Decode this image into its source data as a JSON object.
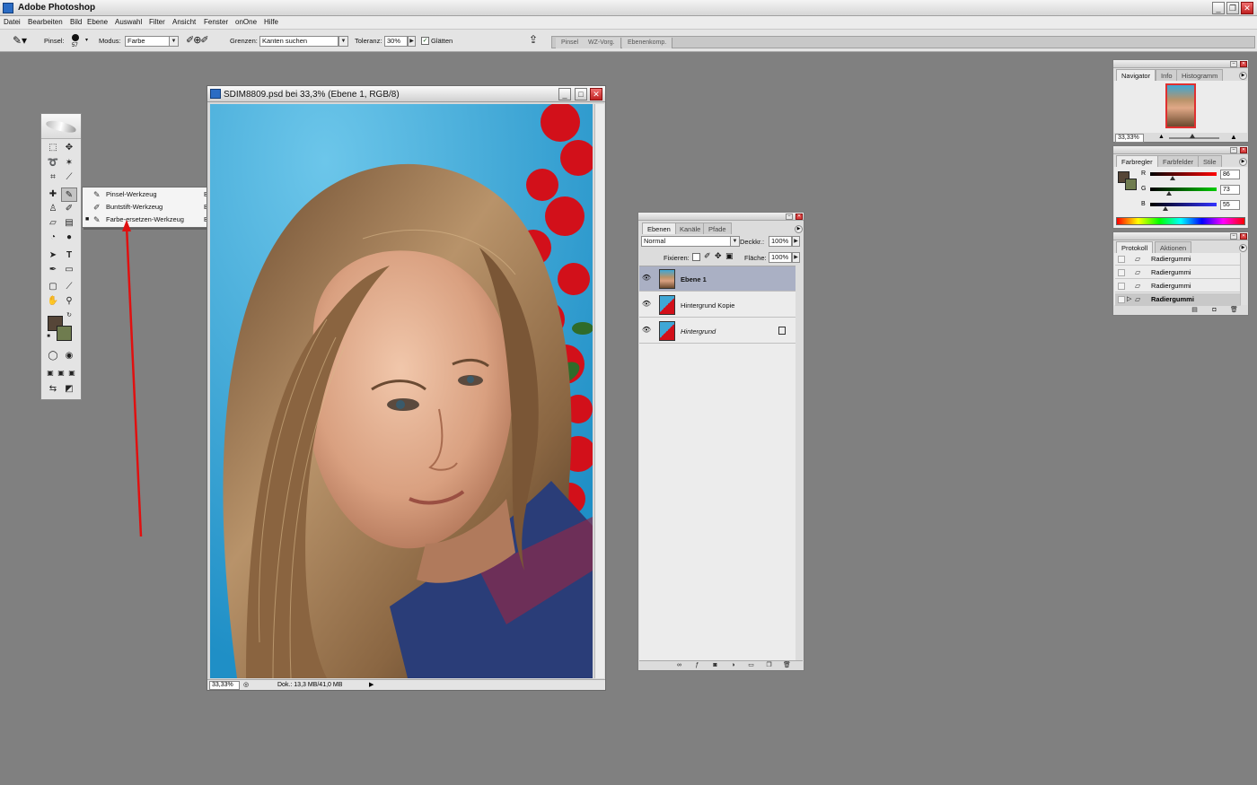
{
  "app": {
    "title": "Adobe Photoshop"
  },
  "menu": [
    "Datei",
    "Bearbeiten",
    "Bild",
    "Ebene",
    "Auswahl",
    "Filter",
    "Ansicht",
    "Fenster",
    "onOne",
    "Hilfe"
  ],
  "options": {
    "brush_label": "Pinsel:",
    "brush_size": "57",
    "mode_label": "Modus:",
    "mode_value": "Farbe",
    "limits_label": "Grenzen:",
    "limits_value": "Kanten suchen",
    "tolerance_label": "Toleranz:",
    "tolerance_value": "30%",
    "antialias_label": "Glätten",
    "antialias_checked": true
  },
  "palette_well": [
    "Pinsel",
    "WZ-Vorg.",
    "Ebenenkomp."
  ],
  "flyout": {
    "items": [
      {
        "label": "Pinsel-Werkzeug",
        "key": "B",
        "selected": false
      },
      {
        "label": "Buntstift-Werkzeug",
        "key": "B",
        "selected": false
      },
      {
        "label": "Farbe-ersetzen-Werkzeug",
        "key": "B",
        "selected": true
      }
    ]
  },
  "document": {
    "title": "SDIM8809.psd bei 33,3% (Ebene 1, RGB/8)",
    "zoom": "33,33%",
    "doc_info": "Dok.: 13,3 MB/41,0 MB"
  },
  "layers": {
    "tabs": [
      "Ebenen",
      "Kanäle",
      "Pfade"
    ],
    "blend_mode": "Normal",
    "opacity_label": "Deckkr.:",
    "opacity_value": "100%",
    "lock_label": "Fixieren:",
    "fill_label": "Fläche:",
    "fill_value": "100%",
    "items": [
      {
        "name": "Ebene 1",
        "selected": true,
        "locked": false
      },
      {
        "name": "Hintergrund Kopie",
        "selected": false,
        "locked": false
      },
      {
        "name": "Hintergrund",
        "selected": false,
        "locked": true
      }
    ]
  },
  "navigator": {
    "tabs": [
      "Navigator",
      "Info",
      "Histogramm"
    ],
    "zoom": "33,33%"
  },
  "color": {
    "tabs": [
      "Farbregler",
      "Farbfelder",
      "Stile"
    ],
    "channels": [
      {
        "label": "R",
        "value": "86"
      },
      {
        "label": "G",
        "value": "73"
      },
      {
        "label": "B",
        "value": "55"
      }
    ],
    "foreground": "#564637",
    "background": "#6f7c4f"
  },
  "history": {
    "tabs": [
      "Protokoll",
      "Aktionen"
    ],
    "items": [
      {
        "label": "Radiergummi",
        "current": false
      },
      {
        "label": "Radiergummi",
        "current": false
      },
      {
        "label": "Radiergummi",
        "current": false
      },
      {
        "label": "Radiergummi",
        "current": true
      }
    ]
  }
}
